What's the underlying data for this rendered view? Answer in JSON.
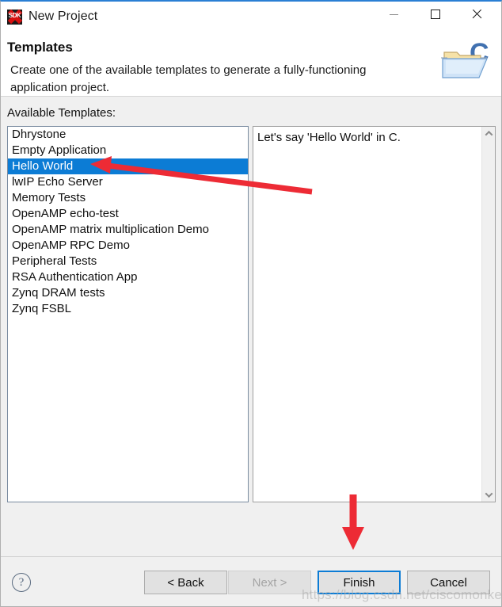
{
  "window": {
    "title": "New Project",
    "app_icon": "sdk-icon",
    "controls": {
      "minimize": "minimize-icon",
      "maximize": "maximize-icon",
      "close": "close-icon"
    }
  },
  "header": {
    "title": "Templates",
    "description": "Create one of the available templates to generate a fully-functioning application project.",
    "icon": "folder-c-icon"
  },
  "main": {
    "list_label": "Available Templates:",
    "templates": [
      {
        "label": "Dhrystone",
        "selected": false
      },
      {
        "label": "Empty Application",
        "selected": false
      },
      {
        "label": "Hello World",
        "selected": true
      },
      {
        "label": "lwIP Echo Server",
        "selected": false
      },
      {
        "label": "Memory Tests",
        "selected": false
      },
      {
        "label": "OpenAMP echo-test",
        "selected": false
      },
      {
        "label": "OpenAMP matrix multiplication Demo",
        "selected": false
      },
      {
        "label": "OpenAMP RPC Demo",
        "selected": false
      },
      {
        "label": "Peripheral Tests",
        "selected": false
      },
      {
        "label": "RSA Authentication App",
        "selected": false
      },
      {
        "label": "Zynq DRAM tests",
        "selected": false
      },
      {
        "label": "Zynq FSBL",
        "selected": false
      }
    ],
    "description_text": "Let's say 'Hello World' in C.",
    "scrollbar": {
      "up_arrow": "chevron-up-icon",
      "down_arrow": "chevron-down-icon"
    }
  },
  "footer": {
    "help": "?",
    "back_label": "< Back",
    "next_label": "Next >",
    "finish_label": "Finish",
    "cancel_label": "Cancel"
  },
  "annotations": {
    "arrow_to_selection": "red-arrow-pointing-to-hello-world",
    "arrow_to_finish": "red-arrow-pointing-to-finish"
  },
  "watermark": "https://blog.csdn.net/ciscomonkey",
  "colors": {
    "selection": "#0c7cd5",
    "focus": "#0c7cd5",
    "annotation": "#ed2b35",
    "dialog_bg": "#f0f0f0"
  }
}
